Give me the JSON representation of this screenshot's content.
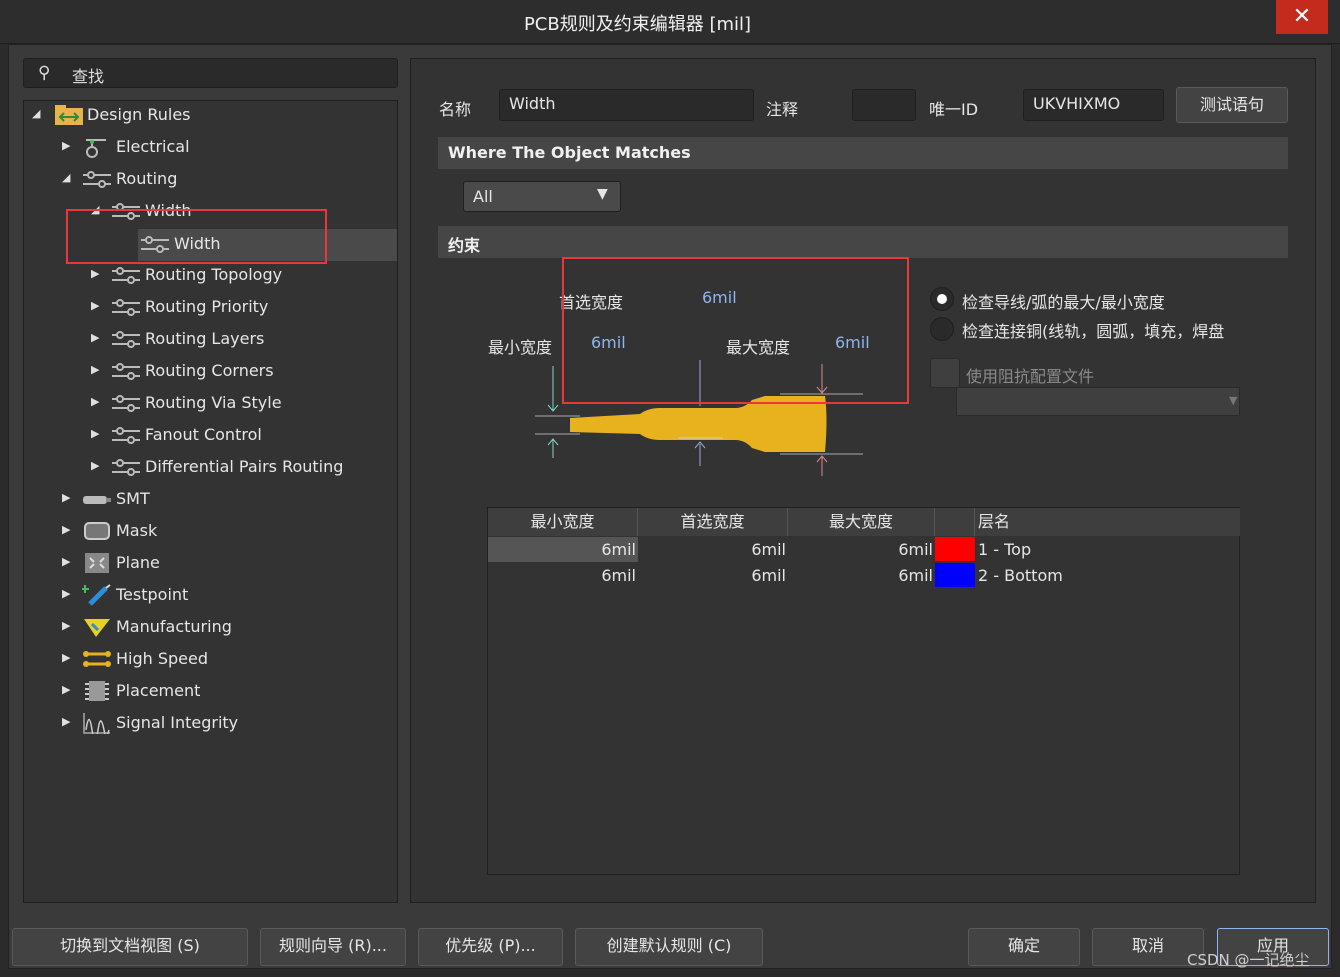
{
  "window": {
    "title": "PCB规则及约束编辑器 [mil]",
    "close": "✕"
  },
  "search": {
    "placeholder": "查找"
  },
  "tree": {
    "root": "Design Rules",
    "items": [
      {
        "label": "Electrical"
      },
      {
        "label": "Routing"
      },
      {
        "label": "Width"
      },
      {
        "label": "Width"
      },
      {
        "label": "Routing Topology"
      },
      {
        "label": "Routing Priority"
      },
      {
        "label": "Routing Layers"
      },
      {
        "label": "Routing Corners"
      },
      {
        "label": "Routing Via Style"
      },
      {
        "label": "Fanout Control"
      },
      {
        "label": "Differential Pairs Routing"
      },
      {
        "label": "SMT"
      },
      {
        "label": "Mask"
      },
      {
        "label": "Plane"
      },
      {
        "label": "Testpoint"
      },
      {
        "label": "Manufacturing"
      },
      {
        "label": "High Speed"
      },
      {
        "label": "Placement"
      },
      {
        "label": "Signal Integrity"
      }
    ]
  },
  "rule": {
    "name_label": "名称",
    "name_value": "Width",
    "comment_label": "注释",
    "comment_value": "",
    "uid_label": "唯一ID",
    "uid_value": "UKVHIXMO",
    "test_button": "测试语句",
    "where_header": "Where The Object Matches",
    "match_value": "All",
    "constraint_header": "约束"
  },
  "constraints": {
    "pref_label": "首选宽度",
    "pref_value": "6mil",
    "min_label": "最小宽度",
    "min_value": "6mil",
    "max_label": "最大宽度",
    "max_value": "6mil",
    "option1": "检查导线/弧的最大/最小宽度",
    "option2": "检查连接铜(线轨，圆弧，填充，焊盘",
    "impedance": "使用阻抗配置文件",
    "trace_color": "#e8b21f"
  },
  "table": {
    "headers": [
      "最小宽度",
      "首选宽度",
      "最大宽度",
      "",
      "层名"
    ],
    "rows": [
      {
        "min": "6mil",
        "pref": "6mil",
        "max": "6mil",
        "color": "#ff0000",
        "layer": "1 - Top"
      },
      {
        "min": "6mil",
        "pref": "6mil",
        "max": "6mil",
        "color": "#0000ff",
        "layer": "2 - Bottom"
      }
    ]
  },
  "footer": {
    "switch": "切换到文档视图 (S)",
    "wizard": "规则向导 (R)...",
    "priority": "优先级 (P)...",
    "default": "创建默认规则 (C)",
    "ok": "确定",
    "cancel": "取消",
    "apply": "应用"
  },
  "watermark": "CSDN @一记绝尘"
}
